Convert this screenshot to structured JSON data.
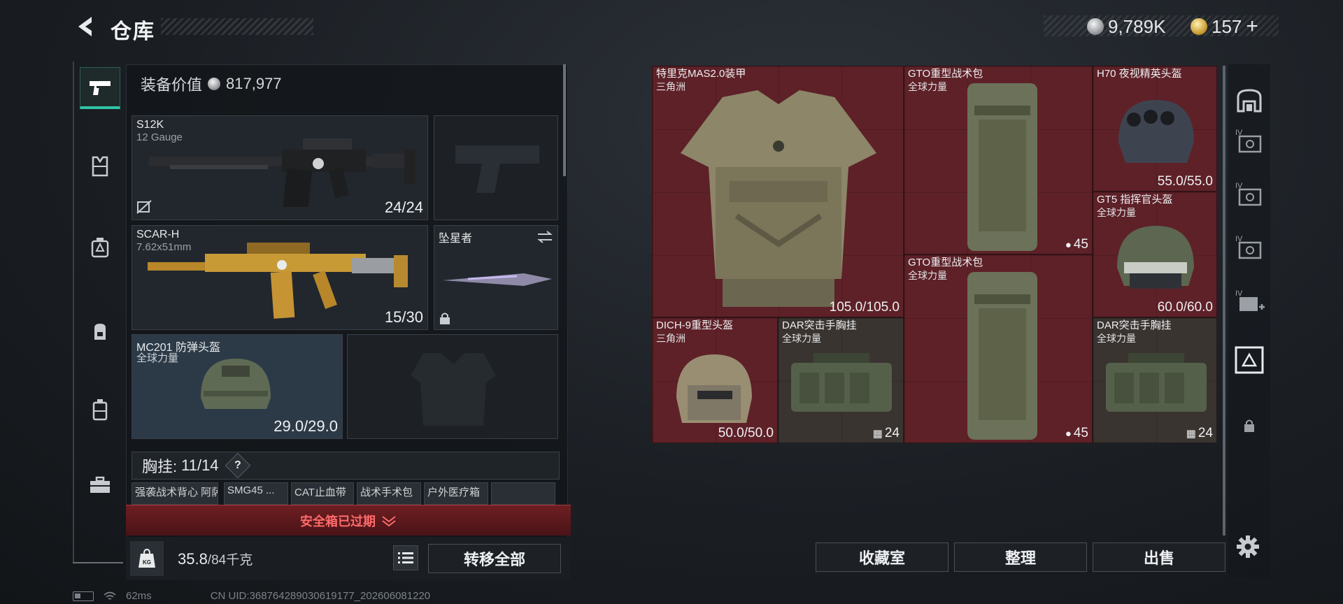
{
  "header": {
    "title": "仓库",
    "currencies": [
      {
        "icon": "silver-coin-icon",
        "value": "9,789K"
      },
      {
        "icon": "gold-coin-icon",
        "value": "157",
        "suffix": "+"
      }
    ]
  },
  "left_tabs": [
    {
      "icon": "pistol-icon",
      "active": true
    },
    {
      "icon": "armor-vest-icon",
      "active": false
    },
    {
      "icon": "chest-rig-icon",
      "active": false
    },
    {
      "icon": "backpack-icon",
      "active": false
    },
    {
      "icon": "container-icon",
      "active": false
    },
    {
      "icon": "toolbox-icon",
      "active": false
    }
  ],
  "equipment": {
    "value_label": "装备价值",
    "value": "817,977",
    "slots": [
      {
        "name": "S12K",
        "sub": "12 Gauge",
        "count": "24/24"
      },
      {
        "name": "",
        "sub": "",
        "count": "",
        "empty": "pistol"
      },
      {
        "name": "SCAR-H",
        "sub": "7.62x51mm",
        "count": "15/30"
      },
      {
        "name": "坠星者",
        "sub": "",
        "count": ""
      },
      {
        "name": "MC201 防弹头盔",
        "sub": "全球力量",
        "count": "29.0/29.0"
      },
      {
        "name": "",
        "sub": "",
        "count": "",
        "empty": "armor"
      }
    ],
    "chest_label": "胸挂:",
    "chest_count": "11/14",
    "help": "?",
    "chest_items": [
      "强袭战术背心 阿萨拉",
      "SMG45 ...",
      "CAT止血带",
      "战术手术包",
      "户外医疗箱",
      ""
    ],
    "expired_text": "安全箱已过期",
    "weight_current": "35.8",
    "weight_max": "/84千克",
    "transfer_all": "转移全部"
  },
  "stash": {
    "items": [
      {
        "name": "特里克MAS2.0装甲",
        "sub": "三角洲",
        "value": "105.0/105.0"
      },
      {
        "name": "GTO重型战术包",
        "sub": "全球力量",
        "value": "45",
        "value_icon": "capacity-icon"
      },
      {
        "name": "H70 夜视精英头盔",
        "sub": "",
        "value": "55.0/55.0"
      },
      {
        "name": "GT5 指挥官头盔",
        "sub": "全球力量",
        "value": "60.0/60.0"
      },
      {
        "name": "GTO重型战术包",
        "sub": "全球力量",
        "value": "45",
        "value_icon": "capacity-icon"
      },
      {
        "name": "DICH-9重型头盔",
        "sub": "三角洲",
        "value": "50.0/50.0"
      },
      {
        "name": "DAR突击手胸挂",
        "sub": "全球力量",
        "value": "24",
        "value_icon": "rig-icon"
      },
      {
        "name": "DAR突击手胸挂",
        "sub": "全球力量",
        "value": "24",
        "value_icon": "rig-icon"
      }
    ],
    "buttons": {
      "collection": "收藏室",
      "sort": "整理",
      "sell": "出售"
    }
  },
  "right_tabs": [
    {
      "icon": "stash-icon",
      "label": ""
    },
    {
      "icon": "case-icon",
      "label": "IV"
    },
    {
      "icon": "case-icon",
      "label": "IV"
    },
    {
      "icon": "case-icon",
      "label": "IV"
    },
    {
      "icon": "add-case-icon",
      "label": "IV"
    },
    {
      "icon": "case-selected-icon",
      "label": ""
    },
    {
      "icon": "lock-icon",
      "label": ""
    },
    {
      "icon": "gear-icon",
      "label": ""
    }
  ],
  "status": {
    "ping": "62ms",
    "uid": "CN UID:36876428903061917​7_202606081220"
  },
  "colors": {
    "accent": "#2fc4a6",
    "danger": "#ff6a6a",
    "stash_red": "#5e2128"
  }
}
